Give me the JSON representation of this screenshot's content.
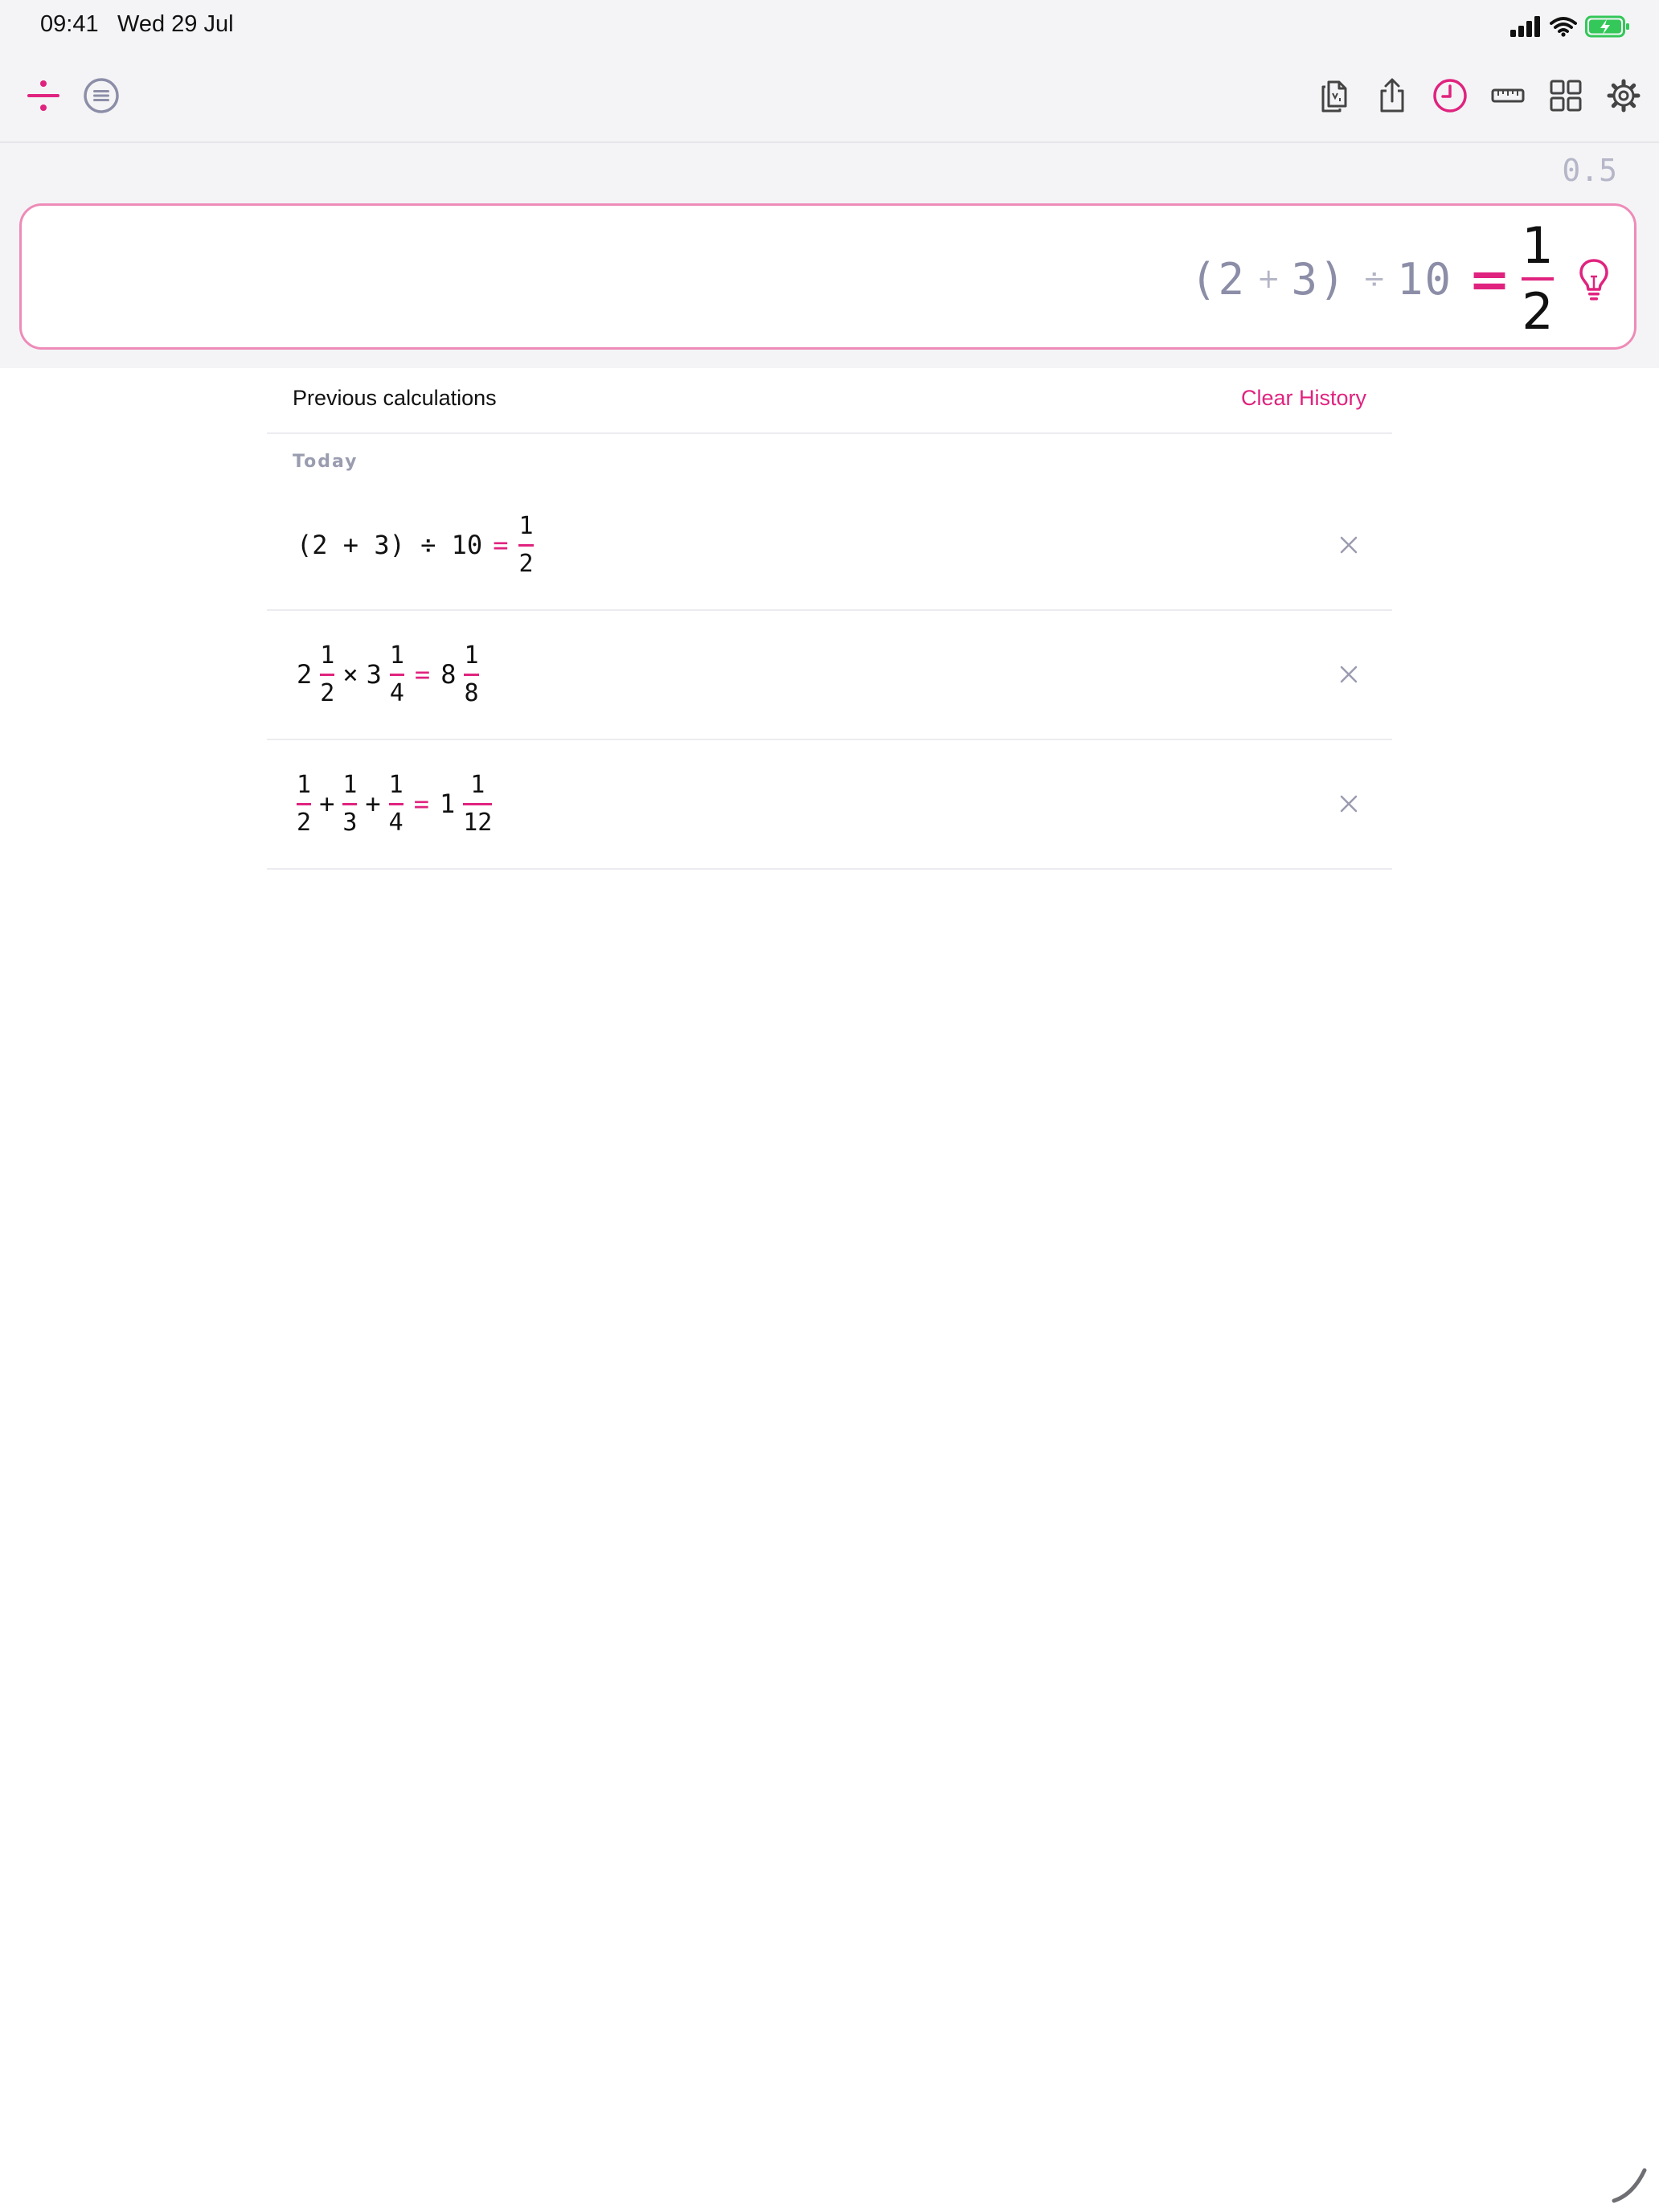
{
  "status_bar": {
    "time": "09:41",
    "date": "Wed 29 Jul",
    "battery_color": "#34c759"
  },
  "toolbar": {
    "left": [
      "divide-icon",
      "menu-circle-icon"
    ],
    "right": [
      "copy-icon",
      "share-icon",
      "history-icon",
      "ruler-icon",
      "grid-icon",
      "gear-icon"
    ],
    "accent": "#e0237f"
  },
  "calculator": {
    "previous_result": "0.5",
    "expression": {
      "open_paren": "(",
      "a": "2",
      "op1": "+",
      "b": "3",
      "close_paren": ")",
      "op2": "÷",
      "c": "10",
      "equals": "=",
      "result_num": "1",
      "result_den": "2"
    }
  },
  "history": {
    "title": "Previous calculations",
    "clear_label": "Clear History",
    "section": "Today",
    "rows": [
      {
        "expr": "(2 + 3) ÷ 10",
        "equals": "=",
        "result": {
          "num": "1",
          "den": "2"
        }
      },
      {
        "a_whole": "2",
        "a_num": "1",
        "a_den": "2",
        "op": "×",
        "b_whole": "3",
        "b_num": "1",
        "b_den": "4",
        "equals": "=",
        "r_whole": "8",
        "r_num": "1",
        "r_den": "8"
      },
      {
        "f1_num": "1",
        "f1_den": "2",
        "op1": "+",
        "f2_num": "1",
        "f2_den": "3",
        "op2": "+",
        "f3_num": "1",
        "f3_den": "4",
        "equals": "=",
        "r_whole": "1",
        "r_num": "1",
        "r_den": "12"
      }
    ]
  }
}
